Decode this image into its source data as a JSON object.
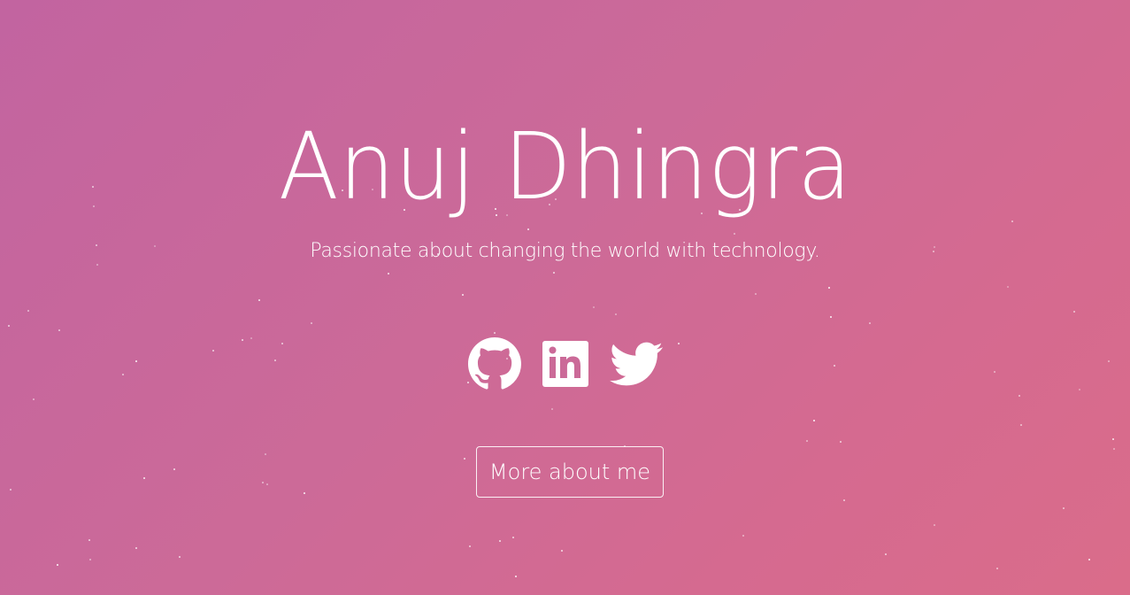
{
  "hero": {
    "name": "Anuj Dhingra",
    "tagline": "Passionate about changing the world with technology."
  },
  "socials": [
    {
      "icon": "github-icon",
      "label": "GitHub"
    },
    {
      "icon": "linkedin-icon",
      "label": "LinkedIn"
    },
    {
      "icon": "twitter-icon",
      "label": "Twitter"
    }
  ],
  "cta": {
    "label": "More about me"
  },
  "colors": {
    "background_start": "#c264a0",
    "background_end": "#da6c8a",
    "text": "#ffffff"
  }
}
